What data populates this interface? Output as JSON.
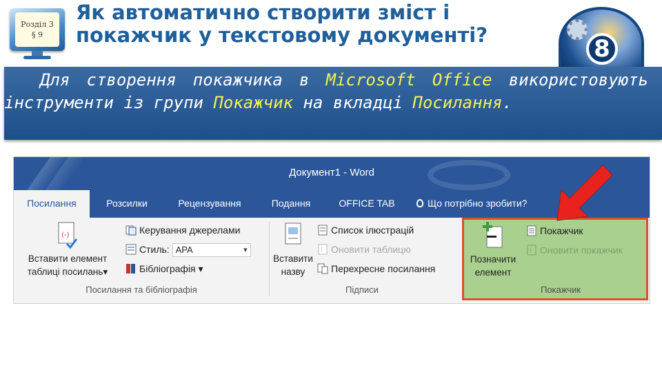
{
  "header": {
    "section_line1": "Розділ 3",
    "section_line2": "§ 9",
    "title": "Як автоматично створити зміст і покажчик у текстовому документі?",
    "grade": "8"
  },
  "description": {
    "part1": "Для створення покажчика в ",
    "hl1": "Microsoft Office",
    "part2": " використовують інструменти із групи ",
    "hl2": "Покажчик",
    "part3": " на вкладці ",
    "hl3": "Посилання",
    "part4": "."
  },
  "word": {
    "window_title": "Документ1 - Word",
    "tabs": [
      "Посилання",
      "Розсилки",
      "Рецензування",
      "Подання",
      "OFFICE TAB",
      "Що потрібно зробити?"
    ],
    "group_citations": {
      "label": "Посилання та бібліографія",
      "insert_citation": "Вставити елемент таблиці посилань",
      "insert_citation_arrow": "▾",
      "manage_sources": "Керування джерелами",
      "style_label": "Стиль:",
      "style_value": "APA",
      "bibliography": "Бібліографія",
      "bibliography_arrow": "▾"
    },
    "group_captions": {
      "label": "Підписи",
      "insert_caption": "Вставити назву",
      "table_of_figures": "Список ілюстрацій",
      "update_table": "Оновити таблицю",
      "cross_reference": "Перехресне посилання"
    },
    "group_index": {
      "label": "Покажчик",
      "mark_entry": "Позначити елемент",
      "insert_index": "Покажчик",
      "update_index": "Оновити покажчик"
    }
  },
  "colors": {
    "title_blue": "#1f5f9a",
    "band_blue": "#1f4f8a",
    "highlight_yellow": "#f3f05a",
    "word_blue": "#2b579a",
    "index_group_green": "#a9d08e",
    "callout_red": "#e8231d"
  }
}
